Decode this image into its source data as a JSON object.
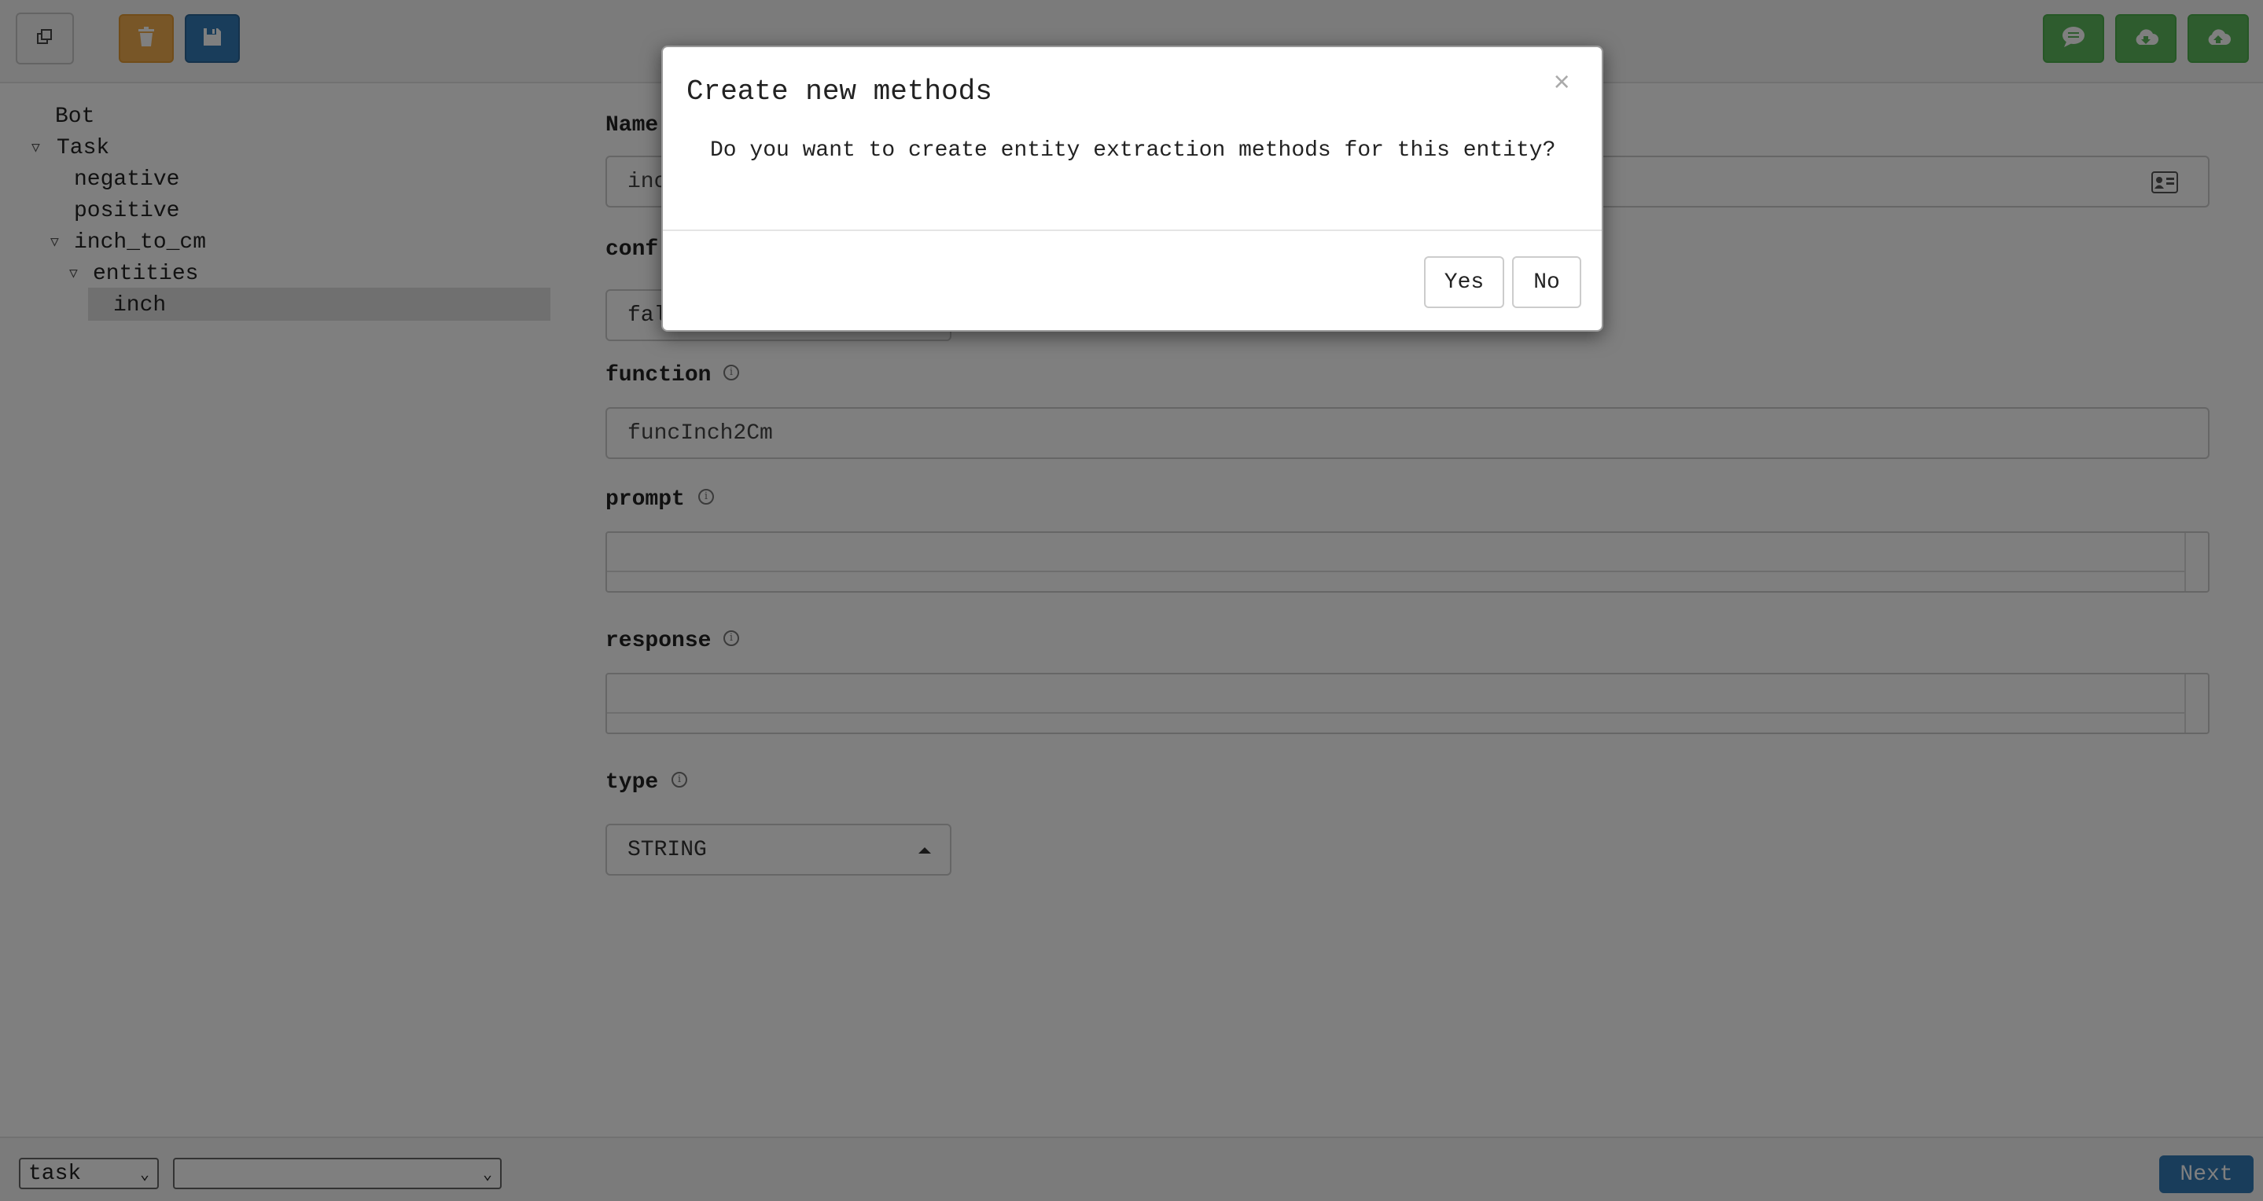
{
  "toolbar": {
    "left_icons": [
      "copy-icon",
      "trash-icon",
      "save-icon"
    ],
    "right_icons": [
      "chat-icon",
      "cloud-download-icon",
      "cloud-upload-icon"
    ]
  },
  "tree": {
    "items": [
      {
        "label": "Bot",
        "expanded": null
      },
      {
        "label": "Task",
        "expanded": true
      },
      {
        "label": "negative",
        "expanded": null
      },
      {
        "label": "positive",
        "expanded": null
      },
      {
        "label": "inch_to_cm",
        "expanded": true
      },
      {
        "label": "entities",
        "expanded": true
      },
      {
        "label": "inch",
        "expanded": null,
        "selected": true
      }
    ]
  },
  "form": {
    "name_label": "Name",
    "name_value": "inc",
    "confirm_label": "conf",
    "confirm_value": "fal",
    "function_label": "function",
    "function_value": "funcInch2Cm",
    "prompt_label": "prompt",
    "prompt_value": "",
    "response_label": "response",
    "response_value": "",
    "type_label": "type",
    "type_value": "STRING"
  },
  "bottom": {
    "select1_value": "task",
    "select2_value": "",
    "next_label": "Next"
  },
  "modal": {
    "title": "Create new methods",
    "close": "×",
    "body": "Do you want to create entity extraction methods for this entity?",
    "yes_label": "Yes",
    "no_label": "No"
  },
  "colors": {
    "warning": "#f0ad4e",
    "primary": "#337ab7",
    "success": "#5cb85c",
    "overlay": "rgba(0,0,0,0.5)"
  }
}
